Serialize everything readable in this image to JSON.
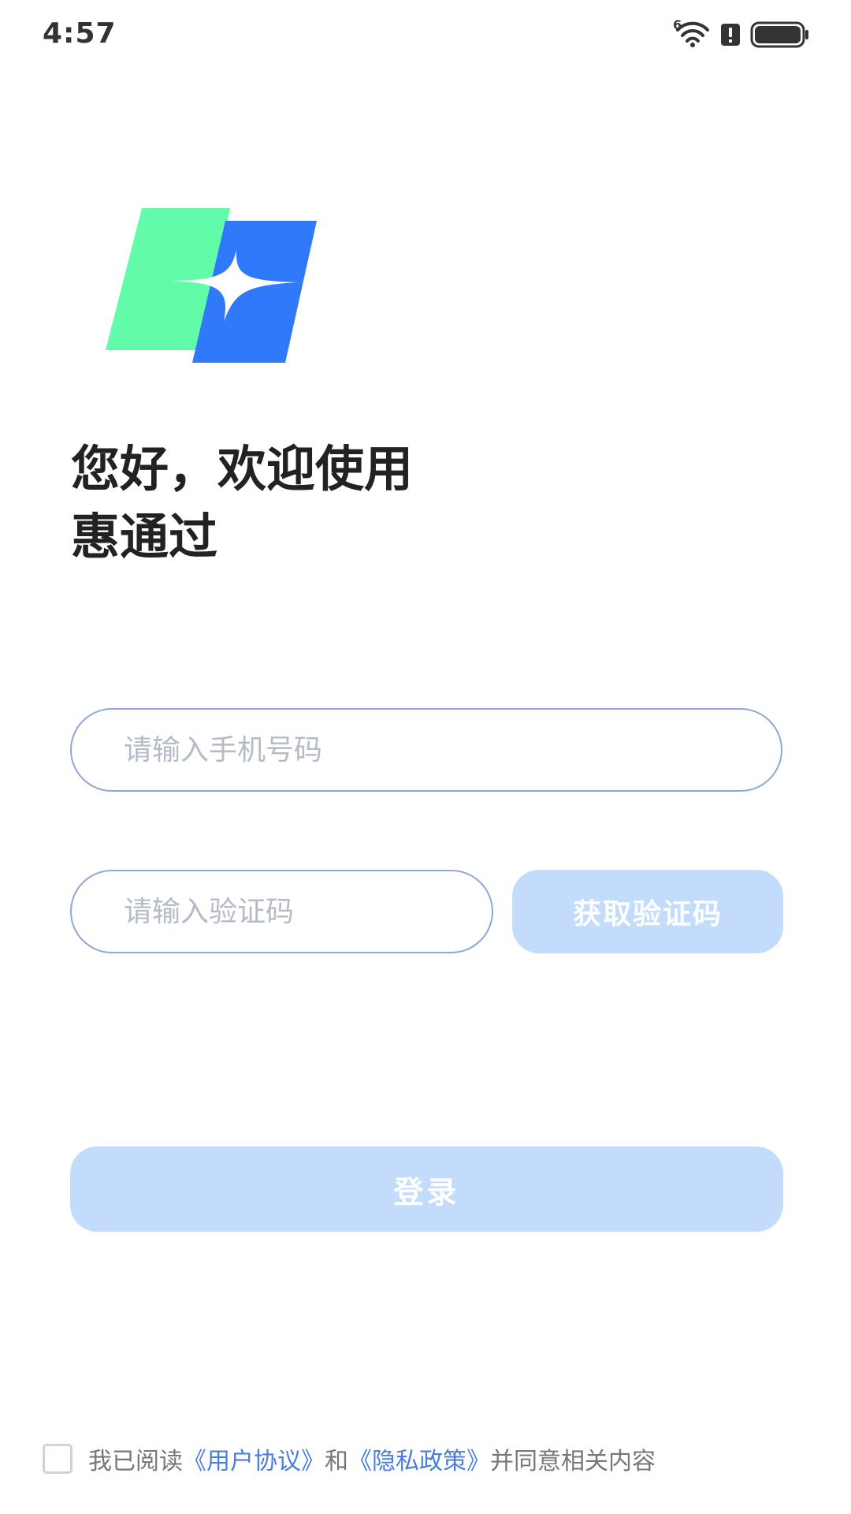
{
  "status_bar": {
    "time": "4:57",
    "wifi_badge": "6",
    "icons": [
      "wifi-icon",
      "alert-icon",
      "battery-icon"
    ]
  },
  "brand": {
    "logo_icon": "app-logo-icon",
    "colors": {
      "green": "#62fbaa",
      "blue": "#3179fb"
    }
  },
  "welcome": {
    "line1": "您好，欢迎使用",
    "line2": "惠通过"
  },
  "phone": {
    "placeholder": "请输入手机号码",
    "value": ""
  },
  "code": {
    "placeholder": "请输入验证码",
    "value": "",
    "button_label": "获取验证码"
  },
  "login": {
    "label": "登录"
  },
  "agreement": {
    "checked": false,
    "prefix": "我已阅读",
    "user_agreement": "《用户协议》",
    "conjunction": "和",
    "privacy_policy": "《隐私政策》",
    "suffix": "并同意相关内容"
  },
  "colors": {
    "accent_disabled": "#c4dcfb",
    "field_border": "#8fa9d4",
    "link": "#4a7ed8"
  }
}
